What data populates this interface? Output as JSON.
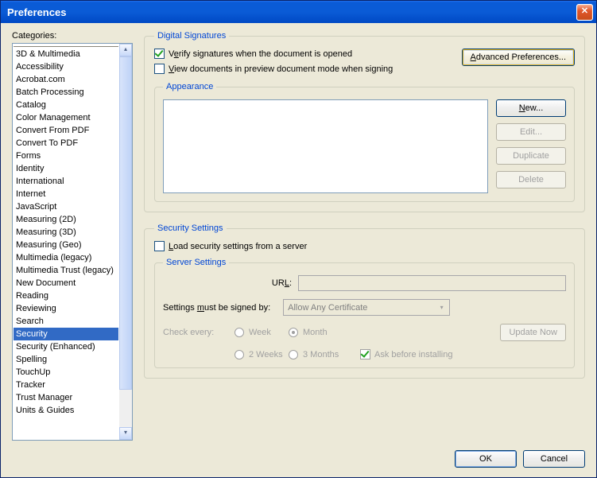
{
  "title": "Preferences",
  "categories_label": "Categories:",
  "categories": [
    "3D & Multimedia",
    "Accessibility",
    "Acrobat.com",
    "Batch Processing",
    "Catalog",
    "Color Management",
    "Convert From PDF",
    "Convert To PDF",
    "Forms",
    "Identity",
    "International",
    "Internet",
    "JavaScript",
    "Measuring (2D)",
    "Measuring (3D)",
    "Measuring (Geo)",
    "Multimedia (legacy)",
    "Multimedia Trust (legacy)",
    "New Document",
    "Reading",
    "Reviewing",
    "Search",
    "Security",
    "Security (Enhanced)",
    "Spelling",
    "TouchUp",
    "Tracker",
    "Trust Manager",
    "Units & Guides"
  ],
  "selected_category_index": 22,
  "digital_signatures": {
    "legend": "Digital Signatures",
    "verify_checked": true,
    "verify_pre": "V",
    "verify_und": "e",
    "verify_post": "rify signatures when the document is opened",
    "preview_checked": false,
    "preview_und": "V",
    "preview_post": "iew documents in preview document mode when signing",
    "advanced_und": "A",
    "advanced_post": "dvanced Preferences...",
    "appearance_legend": "Appearance",
    "new_und": "N",
    "new_post": "ew...",
    "edit_label": "Edit...",
    "duplicate_label": "Duplicate",
    "delete_label": "Delete"
  },
  "security_settings": {
    "legend": "Security Settings",
    "load_checked": false,
    "load_und": "L",
    "load_post": "oad security settings from a server",
    "server_legend": "Server Settings",
    "url_pre": "UR",
    "url_und": "L",
    "url_post": ":",
    "url_value": "",
    "signed_by_pre": "Settings ",
    "signed_by_und": "m",
    "signed_by_post": "ust be signed by:",
    "signed_by_value": "Allow Any Certificate",
    "check_every_label": "Check every:",
    "opts": {
      "week": "Week",
      "two_weeks": "2 Weeks",
      "month": "Month",
      "three_months": "3 Months"
    },
    "selected_opt": "month",
    "ask_checked": true,
    "ask_label": "Ask before installing",
    "update_label": "Update Now"
  },
  "footer": {
    "ok": "OK",
    "cancel": "Cancel"
  }
}
